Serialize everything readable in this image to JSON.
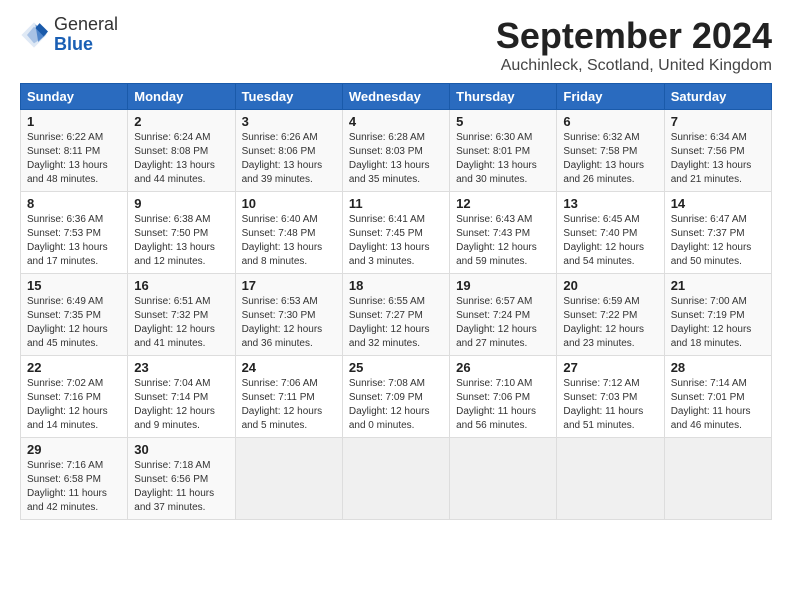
{
  "logo": {
    "general": "General",
    "blue": "Blue"
  },
  "title": "September 2024",
  "location": "Auchinleck, Scotland, United Kingdom",
  "days_of_week": [
    "Sunday",
    "Monday",
    "Tuesday",
    "Wednesday",
    "Thursday",
    "Friday",
    "Saturday"
  ],
  "weeks": [
    [
      {
        "day": "1",
        "text": "Sunrise: 6:22 AM\nSunset: 8:11 PM\nDaylight: 13 hours\nand 48 minutes."
      },
      {
        "day": "2",
        "text": "Sunrise: 6:24 AM\nSunset: 8:08 PM\nDaylight: 13 hours\nand 44 minutes."
      },
      {
        "day": "3",
        "text": "Sunrise: 6:26 AM\nSunset: 8:06 PM\nDaylight: 13 hours\nand 39 minutes."
      },
      {
        "day": "4",
        "text": "Sunrise: 6:28 AM\nSunset: 8:03 PM\nDaylight: 13 hours\nand 35 minutes."
      },
      {
        "day": "5",
        "text": "Sunrise: 6:30 AM\nSunset: 8:01 PM\nDaylight: 13 hours\nand 30 minutes."
      },
      {
        "day": "6",
        "text": "Sunrise: 6:32 AM\nSunset: 7:58 PM\nDaylight: 13 hours\nand 26 minutes."
      },
      {
        "day": "7",
        "text": "Sunrise: 6:34 AM\nSunset: 7:56 PM\nDaylight: 13 hours\nand 21 minutes."
      }
    ],
    [
      {
        "day": "8",
        "text": "Sunrise: 6:36 AM\nSunset: 7:53 PM\nDaylight: 13 hours\nand 17 minutes."
      },
      {
        "day": "9",
        "text": "Sunrise: 6:38 AM\nSunset: 7:50 PM\nDaylight: 13 hours\nand 12 minutes."
      },
      {
        "day": "10",
        "text": "Sunrise: 6:40 AM\nSunset: 7:48 PM\nDaylight: 13 hours\nand 8 minutes."
      },
      {
        "day": "11",
        "text": "Sunrise: 6:41 AM\nSunset: 7:45 PM\nDaylight: 13 hours\nand 3 minutes."
      },
      {
        "day": "12",
        "text": "Sunrise: 6:43 AM\nSunset: 7:43 PM\nDaylight: 12 hours\nand 59 minutes."
      },
      {
        "day": "13",
        "text": "Sunrise: 6:45 AM\nSunset: 7:40 PM\nDaylight: 12 hours\nand 54 minutes."
      },
      {
        "day": "14",
        "text": "Sunrise: 6:47 AM\nSunset: 7:37 PM\nDaylight: 12 hours\nand 50 minutes."
      }
    ],
    [
      {
        "day": "15",
        "text": "Sunrise: 6:49 AM\nSunset: 7:35 PM\nDaylight: 12 hours\nand 45 minutes."
      },
      {
        "day": "16",
        "text": "Sunrise: 6:51 AM\nSunset: 7:32 PM\nDaylight: 12 hours\nand 41 minutes."
      },
      {
        "day": "17",
        "text": "Sunrise: 6:53 AM\nSunset: 7:30 PM\nDaylight: 12 hours\nand 36 minutes."
      },
      {
        "day": "18",
        "text": "Sunrise: 6:55 AM\nSunset: 7:27 PM\nDaylight: 12 hours\nand 32 minutes."
      },
      {
        "day": "19",
        "text": "Sunrise: 6:57 AM\nSunset: 7:24 PM\nDaylight: 12 hours\nand 27 minutes."
      },
      {
        "day": "20",
        "text": "Sunrise: 6:59 AM\nSunset: 7:22 PM\nDaylight: 12 hours\nand 23 minutes."
      },
      {
        "day": "21",
        "text": "Sunrise: 7:00 AM\nSunset: 7:19 PM\nDaylight: 12 hours\nand 18 minutes."
      }
    ],
    [
      {
        "day": "22",
        "text": "Sunrise: 7:02 AM\nSunset: 7:16 PM\nDaylight: 12 hours\nand 14 minutes."
      },
      {
        "day": "23",
        "text": "Sunrise: 7:04 AM\nSunset: 7:14 PM\nDaylight: 12 hours\nand 9 minutes."
      },
      {
        "day": "24",
        "text": "Sunrise: 7:06 AM\nSunset: 7:11 PM\nDaylight: 12 hours\nand 5 minutes."
      },
      {
        "day": "25",
        "text": "Sunrise: 7:08 AM\nSunset: 7:09 PM\nDaylight: 12 hours\nand 0 minutes."
      },
      {
        "day": "26",
        "text": "Sunrise: 7:10 AM\nSunset: 7:06 PM\nDaylight: 11 hours\nand 56 minutes."
      },
      {
        "day": "27",
        "text": "Sunrise: 7:12 AM\nSunset: 7:03 PM\nDaylight: 11 hours\nand 51 minutes."
      },
      {
        "day": "28",
        "text": "Sunrise: 7:14 AM\nSunset: 7:01 PM\nDaylight: 11 hours\nand 46 minutes."
      }
    ],
    [
      {
        "day": "29",
        "text": "Sunrise: 7:16 AM\nSunset: 6:58 PM\nDaylight: 11 hours\nand 42 minutes."
      },
      {
        "day": "30",
        "text": "Sunrise: 7:18 AM\nSunset: 6:56 PM\nDaylight: 11 hours\nand 37 minutes."
      },
      {
        "day": "",
        "text": ""
      },
      {
        "day": "",
        "text": ""
      },
      {
        "day": "",
        "text": ""
      },
      {
        "day": "",
        "text": ""
      },
      {
        "day": "",
        "text": ""
      }
    ]
  ]
}
